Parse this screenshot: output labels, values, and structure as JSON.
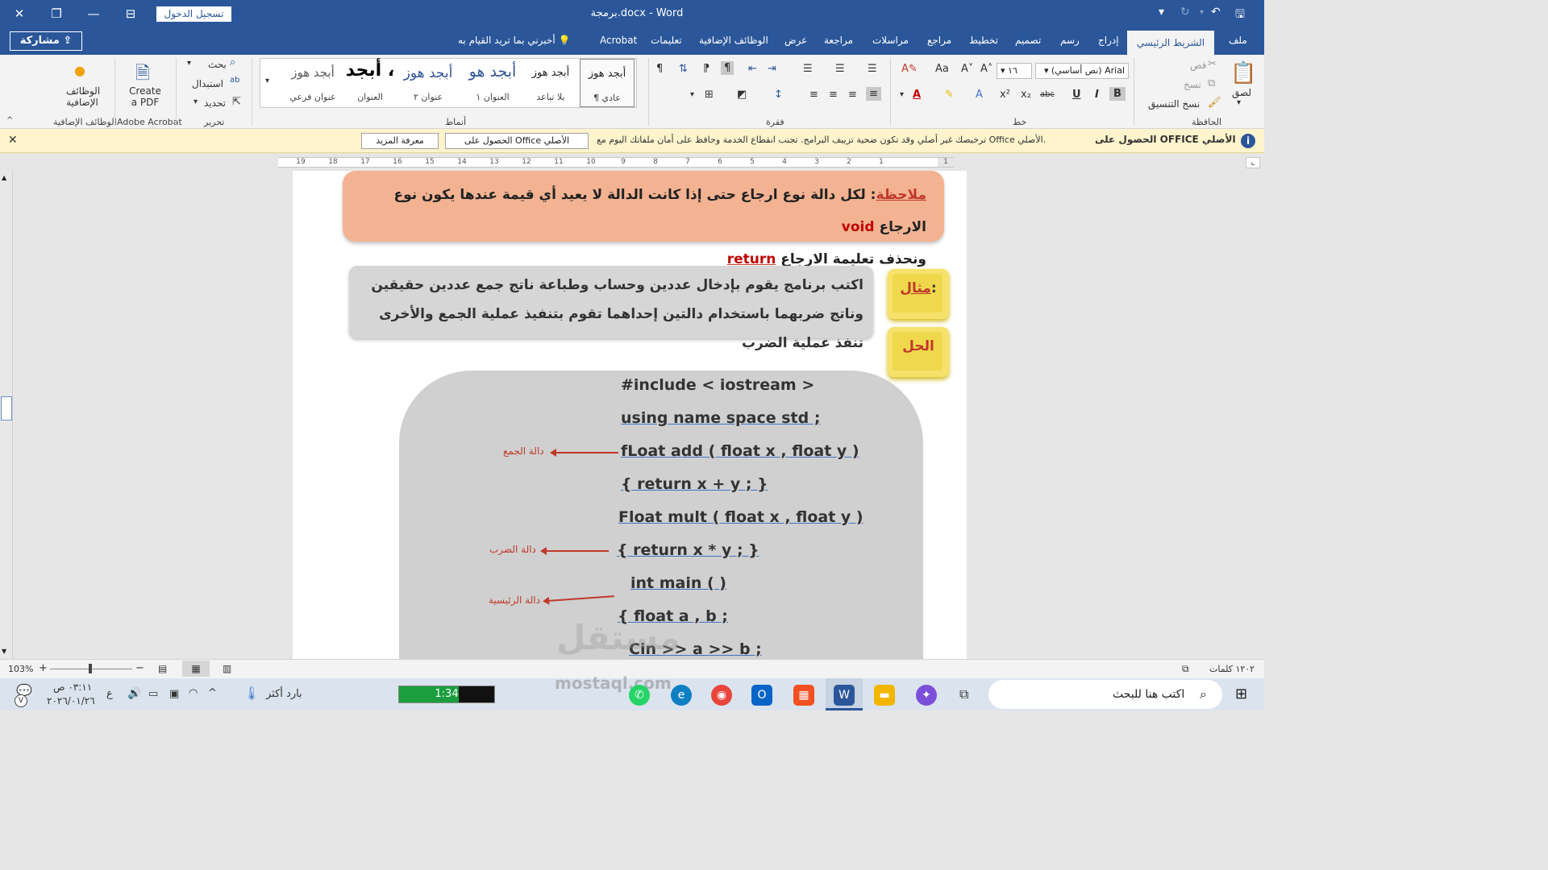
{
  "window": {
    "title": "برمجة.docx  -  Word",
    "signin_label": "تسجيل الدخول"
  },
  "tabs": {
    "share_label": "مشاركة",
    "tell_me": "أخبرني بما تريد القيام به",
    "items": [
      "Acrobat",
      "تعليمات",
      "الوظائف الإضافية",
      "عرض",
      "مراجعة",
      "مراسلات",
      "مراجع",
      "تخطيط",
      "تصميم",
      "رسم",
      "إدراج"
    ],
    "active": "الشريط الرئيسي",
    "file": "ملف"
  },
  "ribbon": {
    "groups": {
      "addins": "الوظائف الإضافية",
      "acrobat": "Adobe Acrobat",
      "editing": "تحرير",
      "styles": "أنماط",
      "paragraph": "فقرة",
      "font": "خط",
      "clipboard": "الحافظة"
    },
    "addins_label": "الوظائف الإضافية",
    "create_pdf": "Create a PDF",
    "find": "بحث",
    "replace": "استبدال",
    "select": "تحديد",
    "styles": [
      {
        "sample": "أبجد هوز",
        "name": "¶ عادي"
      },
      {
        "sample": "أبجد هوز",
        "name": "بلا تباعد"
      },
      {
        "sample": "أبجد هو",
        "name": "العنوان ١"
      },
      {
        "sample": "أبجد هوز",
        "name": "عنوان ٢"
      },
      {
        "sample": "أبجد ،",
        "name": "العنوان"
      },
      {
        "sample": "أبجد هوز",
        "name": "عنوان فرعي"
      }
    ],
    "font_name": "Arial (نص أساسي)",
    "font_size": "١٦",
    "paste": "لصق",
    "cut": "قص",
    "copy": "نسخ",
    "format_painter": "نسخ التنسيق"
  },
  "message_bar": {
    "title": "الحصول على OFFICE الأصلي",
    "text": "ترخيصك غير أصلي وقد تكون ضحية تزييف البرامج. تجنب انقطاع الخدمة وحافظ على أمان ملفاتك اليوم مع Office الأصلي.",
    "get_button": "الحصول على Office الأصلي",
    "learn_button": "معرفة المزيد"
  },
  "ruler": {
    "numbers": [
      "19",
      "18",
      "17",
      "16",
      "15",
      "14",
      "13",
      "12",
      "11",
      "10",
      "9",
      "8",
      "7",
      "6",
      "5",
      "4",
      "3",
      "2",
      "1",
      "1"
    ]
  },
  "document": {
    "note_label": "ملاحظة",
    "note_line1": ": لكل دالة نوع ارجاع حتى إذا كانت الدالة لا يعيد أي قيمة عندها يكون نوع الارجاع",
    "note_void": "void",
    "note_line2": "ونحذف تعليمة الارجاع",
    "note_return": "return",
    "example_label": "مثال",
    "example_colon": ":",
    "example_text": "اكتب برنامج يقوم بإدخال عددين وحساب وطباعة ناتج جمع عددين حقيقين وناتج ضربهما باستخدام دالتين إحداهما تقوم بتنفيذ عملية الجمع والأخرى تنفذ عملية الضرب",
    "solution_label": "الحل",
    "code": [
      "#include < iostream >",
      "using name space std ;",
      "fLoat add ( float x , float y )",
      "{ return x + y ; }",
      "Float mult ( float x , float y )",
      "{ return x * y ; }",
      "int main ( )",
      "{ float a , b ;",
      "Cin >> a >> b ;"
    ],
    "annotations": {
      "add": "دالة الجمع",
      "mult": "دالة الضرب",
      "main": "دالة الرئيسية"
    }
  },
  "status": {
    "zoom": "103%",
    "words": "١٢٠٢ كلمات"
  },
  "taskbar": {
    "search_placeholder": "اكتب هنا للبحث",
    "time": "٠٣:١١ ص",
    "date": "٢٠٢٦/٠١/٢٦",
    "weather": "بارد أكثر",
    "lang": "ع",
    "timer": "1:34",
    "notification_count": "V"
  },
  "watermark": {
    "ar": "مستقل",
    "en": "mostaql.com"
  },
  "colors": {
    "word_blue": "#2b579a",
    "note_bg": "#f3b392",
    "question_bg": "#d6d6d6",
    "tag_yellow": "#f6e26b",
    "code_bg": "#d0d0d0",
    "annotation_red": "#c0392b"
  }
}
